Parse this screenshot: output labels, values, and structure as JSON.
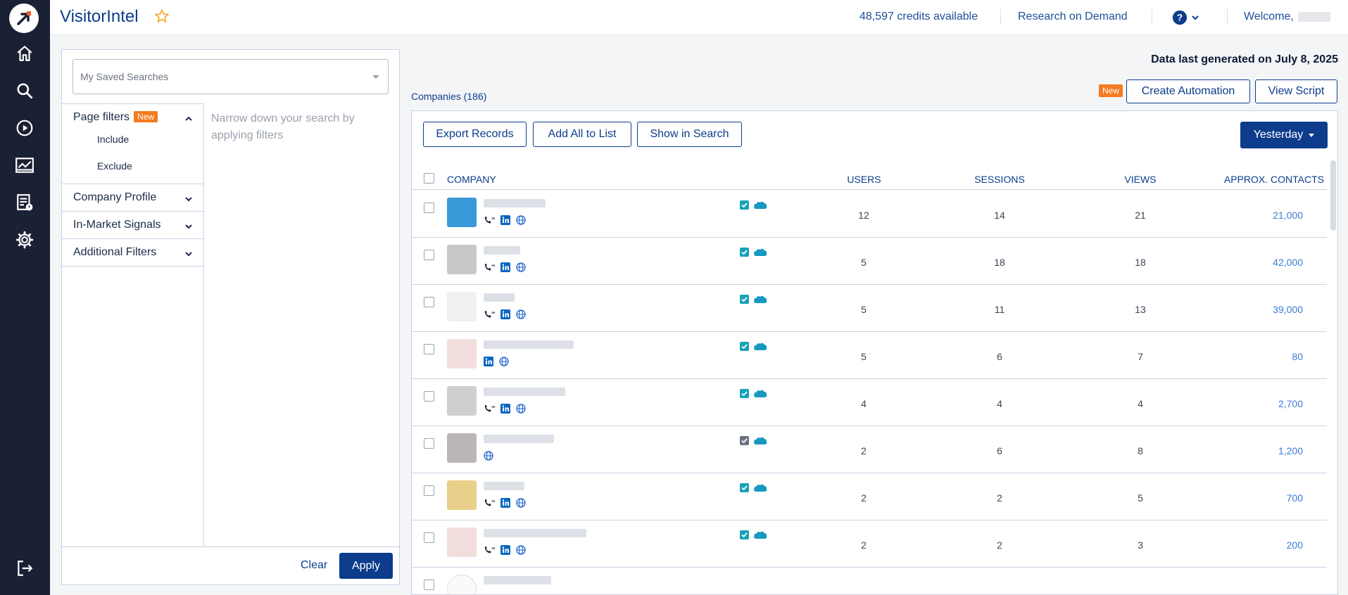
{
  "app": {
    "title": "VisitorIntel"
  },
  "header": {
    "credits": "48,597 credits available",
    "research_on_demand": "Research on Demand",
    "welcome": "Welcome,"
  },
  "rail": {
    "icons": [
      "home-icon",
      "search-icon",
      "play-icon",
      "analytics-icon",
      "report-icon",
      "settings-icon",
      "logout-icon"
    ]
  },
  "filters": {
    "saved_searches_placeholder": "My Saved Searches",
    "page_filters_label": "Page filters",
    "new_badge": "New",
    "include_label": "Include",
    "exclude_label": "Exclude",
    "company_profile_label": "Company Profile",
    "in_market_label": "In-Market Signals",
    "additional_label": "Additional Filters",
    "hint": "Narrow down your search by applying filters",
    "clear_label": "Clear",
    "apply_label": "Apply"
  },
  "main": {
    "generated": "Data last generated on July 8, 2025",
    "companies_label": "Companies (186)",
    "new_badge": "New",
    "create_automation": "Create Automation",
    "view_script": "View Script",
    "export_records": "Export Records",
    "add_all_to_list": "Add All to List",
    "show_in_search": "Show in Search",
    "date_range": "Yesterday"
  },
  "table": {
    "columns": {
      "company": "COMPANY",
      "users": "USERS",
      "sessions": "SESSIONS",
      "views": "VIEWS",
      "contacts": "APPROX. CONTACTS"
    },
    "rows": [
      {
        "users": "12",
        "sessions": "14",
        "views": "21",
        "contacts": "21,000"
      },
      {
        "users": "5",
        "sessions": "18",
        "views": "18",
        "contacts": "42,000"
      },
      {
        "users": "5",
        "sessions": "11",
        "views": "13",
        "contacts": "39,000"
      },
      {
        "users": "5",
        "sessions": "6",
        "views": "7",
        "contacts": "80"
      },
      {
        "users": "4",
        "sessions": "4",
        "views": "4",
        "contacts": "2,700"
      },
      {
        "users": "2",
        "sessions": "6",
        "views": "8",
        "contacts": "1,200"
      },
      {
        "users": "2",
        "sessions": "2",
        "views": "5",
        "contacts": "700"
      },
      {
        "users": "2",
        "sessions": "2",
        "views": "3",
        "contacts": "200"
      }
    ]
  },
  "colors": {
    "brand_navy": "#0d3c8c",
    "rail_bg": "#1b2134",
    "accent_orange": "#f47b20",
    "link_blue": "#3a7bd5"
  }
}
